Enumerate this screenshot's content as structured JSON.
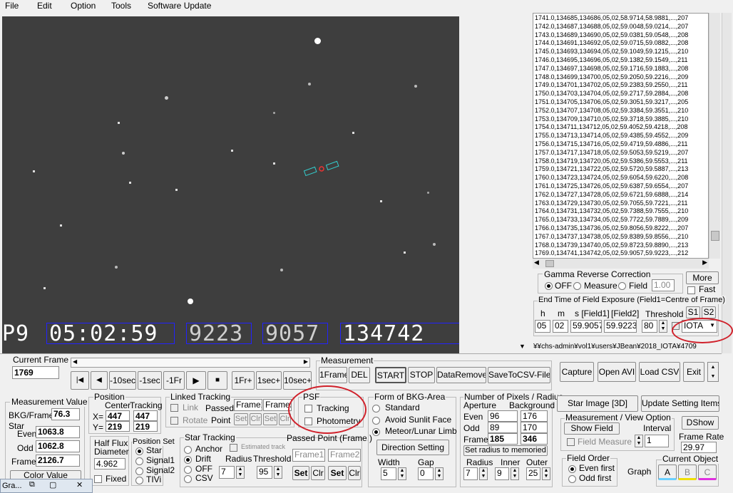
{
  "menu": {
    "file": "File",
    "edit": "Edit",
    "option": "Option",
    "tools": "Tools",
    "software_update": "Software Update"
  },
  "osd": {
    "p": "P9",
    "time": "05:02:59",
    "f1": "9223",
    "f2": "9057",
    "frame": "134742"
  },
  "log_lines": [
    "1741.0,134685,134686,05,02,58.9714,58.9881,...,207",
    "1742.0,134687,134688,05,02,59.0048,59.0214,...,207",
    "1743.0,134689,134690,05,02,59.0381,59.0548,...,208",
    "1744.0,134691,134692,05,02,59.0715,59.0882,...,208",
    "1745.0,134693,134694,05,02,59.1049,59.1215,...,210",
    "1746.0,134695,134696,05,02,59.1382,59.1549,...,211",
    "1747.0,134697,134698,05,02,59.1716,59.1883,...,208",
    "1748.0,134699,134700,05,02,59.2050,59.2216,...,209",
    "1749.0,134701,134702,05,02,59.2383,59.2550,...,211",
    "1750.0,134703,134704,05,02,59.2717,59.2884,...,208",
    "1751.0,134705,134706,05,02,59.3051,59.3217,...,205",
    "1752.0,134707,134708,05,02,59.3384,59.3551,...,210",
    "1753.0,134709,134710,05,02,59.3718,59.3885,...,210",
    "1754.0,134711,134712,05,02,59.4052,59.4218,...,208",
    "1755.0,134713,134714,05,02,59.4385,59.4552,...,209",
    "1756.0,134715,134716,05,02,59.4719,59.4886,...,211",
    "1757.0,134717,134718,05,02,59.5053,59.5219,...,207",
    "1758.0,134719,134720,05,02,59.5386,59.5553,...,211",
    "1759.0,134721,134722,05,02,59.5720,59.5887,...,213",
    "1760.0,134723,134724,05,02,59.6054,59.6220,...,208",
    "1761.0,134725,134726,05,02,59.6387,59.6554,...,207",
    "1762.0,134727,134728,05,02,59.6721,59.6888,...,214",
    "1763.0,134729,134730,05,02,59.7055,59.7221,...,211",
    "1764.0,134731,134732,05,02,59.7388,59.7555,...,210",
    "1765.0,134733,134734,05,02,59.7722,59.7889,...,209",
    "1766.0,134735,134736,05,02,59.8056,59.8222,...,207",
    "1767.0,134737,134738,05,02,59.8389,59.8556,...,210",
    "1768.0,134739,134740,05,02,59.8723,59.8890,...,213",
    "1769.0,134741,134742,05,02,59.9057,59.9223,...,212"
  ],
  "gamma": {
    "title": "Gamma Reverse Correction",
    "off": "OFF",
    "measure": "Measure",
    "field": "Field",
    "value": "1.00",
    "more": "More",
    "fast": "Fast"
  },
  "endtime": {
    "title": "End Time of Field Exposure (Field1=Centre of Frame)",
    "h": "h",
    "m": "m",
    "s": "s [Field1]",
    "f2": "[Field2]",
    "threshold": "Threshold",
    "s1": "S1",
    "s2": "S2",
    "hv": "05",
    "mv": "02",
    "s1v": "59.9057",
    "s2v": "59.9223",
    "thv": "80",
    "mode": "IOTA"
  },
  "path": "¥¥chs-admin¥vol1¥users¥JBean¥2018_IOTA¥4709",
  "current_frame": {
    "label": "Current Frame",
    "value": "1769"
  },
  "transport": {
    "start": "|◀",
    "prev": "◀",
    "m10": "-10sec",
    "m1": "-1sec",
    "m1f": "-1Fr",
    "play": "▶",
    "stop": "■",
    "p1f": "1Fr+",
    "p1": "1sec+",
    "p10": "10sec+"
  },
  "measurement": {
    "title": "Measurement",
    "oneframe": "1Frame",
    "del": "DEL",
    "start": "START",
    "stop": "STOP",
    "dataremove": "DataRemove",
    "savecsv": "SaveToCSV-File"
  },
  "right_buttons": {
    "capture": "Capture",
    "openavi": "Open AVI",
    "loadcsv": "Load CSV",
    "exit": "Exit"
  },
  "mvalue": {
    "title": "Measurement Value",
    "bkg": "BKG/Frame",
    "bkgv": "76.3",
    "star": "Star",
    "even": "Even",
    "evenv": "1063.8",
    "odd": "Odd",
    "oddv": "1062.8",
    "frame": "Frame",
    "framev": "2126.7",
    "colorvalue": "Color Value"
  },
  "position": {
    "title": "Position",
    "center": "Center",
    "tracking": "Tracking",
    "x": "X=",
    "y": "Y=",
    "cx": "447",
    "cy": "219",
    "tx": "447",
    "ty": "219"
  },
  "halfflux": {
    "title": "Half Flux",
    "diameter": "Diameter",
    "value": "4.962",
    "fixed": "Fixed"
  },
  "posset": {
    "title": "Position Set",
    "star": "Star",
    "signal1": "Signal1",
    "signal2": "Signal2",
    "tivi": "TIVi"
  },
  "linked": {
    "title": "Linked Tracking",
    "link": "Link",
    "rotate": "Rotate",
    "passed": "Passed",
    "point": "Point",
    "frame1": "Frame1",
    "frame2": "Frame2",
    "set": "Set",
    "clr": "Clr"
  },
  "psf": {
    "title": "PSF",
    "tracking": "Tracking",
    "photometry": "Photometry"
  },
  "startrack": {
    "title": "Star Tracking",
    "anchor": "Anchor",
    "drift": "Drift",
    "off": "OFF",
    "csv": "CSV",
    "estimated": "Estimated track",
    "radius": "Radius",
    "threshold": "Threshold",
    "radv": "7",
    "thv": "95",
    "passed": "Passed Point (Frame.)",
    "frame1": "Frame1",
    "frame2": "Frame2",
    "set": "Set",
    "clr": "Clr"
  },
  "bkg": {
    "title": "Form of BKG-Area",
    "standard": "Standard",
    "avoid": "Avoid Sunlit Face",
    "meteor": "Meteor/Lunar Limb",
    "dirset": "Direction Setting",
    "width": "Width",
    "gap": "Gap",
    "wv": "5",
    "gv": "0"
  },
  "npix": {
    "title": "Number of Pixels / Radius",
    "aperture": "Aperture",
    "background": "Background",
    "even": "Even",
    "odd": "Odd",
    "frame": "Frame",
    "ea": "96",
    "eb": "176",
    "oa": "89",
    "ob": "170",
    "fa": "185",
    "fb": "346",
    "setradius": "Set  radius to memoried",
    "radius": "Radius",
    "inner": "Inner",
    "outer": "Outer",
    "rv": "7",
    "iv": "9",
    "ov": "25"
  },
  "star3d": "Star Image [3D]",
  "update": "Update Setting Items",
  "mvopt": {
    "title": "Measurement / View Option",
    "showfield": "Show Field",
    "dshow": "DShow",
    "interval": "Interval",
    "intv": "1",
    "fieldmeasure": "Field Measure",
    "framerate": "Frame Rate",
    "frv": "29.97"
  },
  "fieldorder": {
    "title": "Field Order",
    "even": "Even first",
    "odd": "Odd first",
    "graph": "Graph"
  },
  "curobj": {
    "title": "Current Object",
    "a": "A",
    "b": "B",
    "c": "C"
  },
  "taskbar": {
    "label": "Gra..."
  }
}
